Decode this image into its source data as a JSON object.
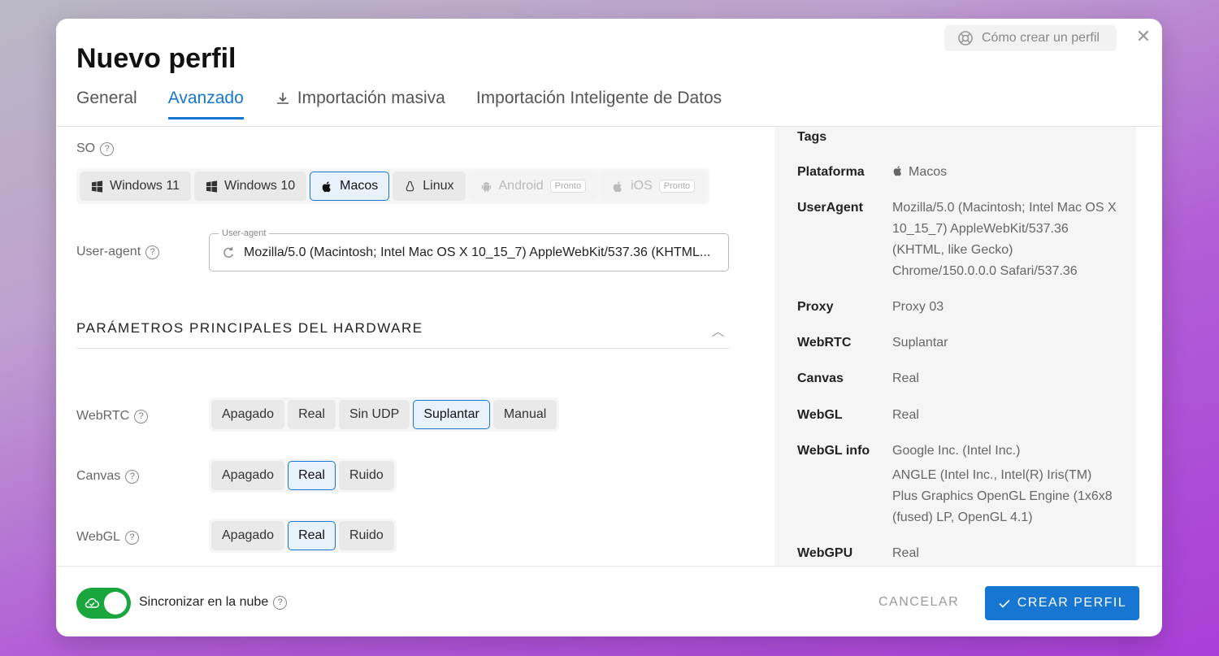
{
  "modal": {
    "title": "Nuevo perfil",
    "help_label": "Cómo crear un perfil",
    "close_icon": "close-icon"
  },
  "tabs": [
    {
      "label": "General",
      "active": false
    },
    {
      "label": "Avanzado",
      "active": true
    },
    {
      "label": "Importación masiva",
      "active": false,
      "icon": "download-icon"
    },
    {
      "label": "Importación Inteligente de Datos",
      "active": false
    }
  ],
  "os": {
    "label": "SO",
    "options": [
      {
        "label": "Windows 11",
        "icon": "windows-icon",
        "selected": false,
        "disabled": false
      },
      {
        "label": "Windows 10",
        "icon": "windows-icon",
        "selected": false,
        "disabled": false
      },
      {
        "label": "Macos",
        "icon": "apple-icon",
        "selected": true,
        "disabled": false
      },
      {
        "label": "Linux",
        "icon": "linux-icon",
        "selected": false,
        "disabled": false
      },
      {
        "label": "Android",
        "icon": "android-icon",
        "selected": false,
        "disabled": true,
        "badge": "Pronto"
      },
      {
        "label": "iOS",
        "icon": "apple-icon",
        "selected": false,
        "disabled": true,
        "badge": "Pronto"
      }
    ]
  },
  "user_agent": {
    "label": "User-agent",
    "field_legend": "User-agent",
    "value": "Mozilla/5.0 (Macintosh; Intel Mac OS X 10_15_7) AppleWebKit/537.36 (KHTML..."
  },
  "hardware": {
    "section_title": "PARÁMETROS PRINCIPALES DEL HARDWARE",
    "webrtc": {
      "label": "WebRTC",
      "options": [
        "Apagado",
        "Real",
        "Sin UDP",
        "Suplantar",
        "Manual"
      ],
      "selected": "Suplantar"
    },
    "canvas": {
      "label": "Canvas",
      "options": [
        "Apagado",
        "Real",
        "Ruido"
      ],
      "selected": "Real"
    },
    "webgl": {
      "label": "WebGL",
      "options": [
        "Apagado",
        "Real",
        "Ruido"
      ],
      "selected": "Real"
    }
  },
  "summary": {
    "tags_key": "Tags",
    "platform_key": "Plataforma",
    "platform_val": "Macos",
    "ua_key": "UserAgent",
    "ua_val": "Mozilla/5.0 (Macintosh; Intel Mac OS X 10_15_7) AppleWebKit/537.36 (KHTML, like Gecko) Chrome/150.0.0.0 Safari/537.36",
    "proxy_key": "Proxy",
    "proxy_val": "Proxy 03",
    "webrtc_key": "WebRTC",
    "webrtc_val": "Suplantar",
    "canvas_key": "Canvas",
    "canvas_val": "Real",
    "webgl_key": "WebGL",
    "webgl_val": "Real",
    "webglinfo_key": "WebGL info",
    "webglinfo_vendor": "Google Inc. (Intel Inc.)",
    "webglinfo_renderer": "ANGLE (Intel Inc., Intel(R) Iris(TM) Plus Graphics OpenGL Engine (1x6x8 (fused) LP, OpenGL 4.1)",
    "webgpu_key": "WebGPU",
    "webgpu_val": "Real"
  },
  "footer": {
    "sync_label": "Sincronizar en la nube",
    "sync_on": true,
    "cancel_label": "CANCELAR",
    "create_label": "CREAR PERFIL"
  },
  "colors": {
    "accent": "#1676d2",
    "toggle_on": "#18a63d"
  }
}
